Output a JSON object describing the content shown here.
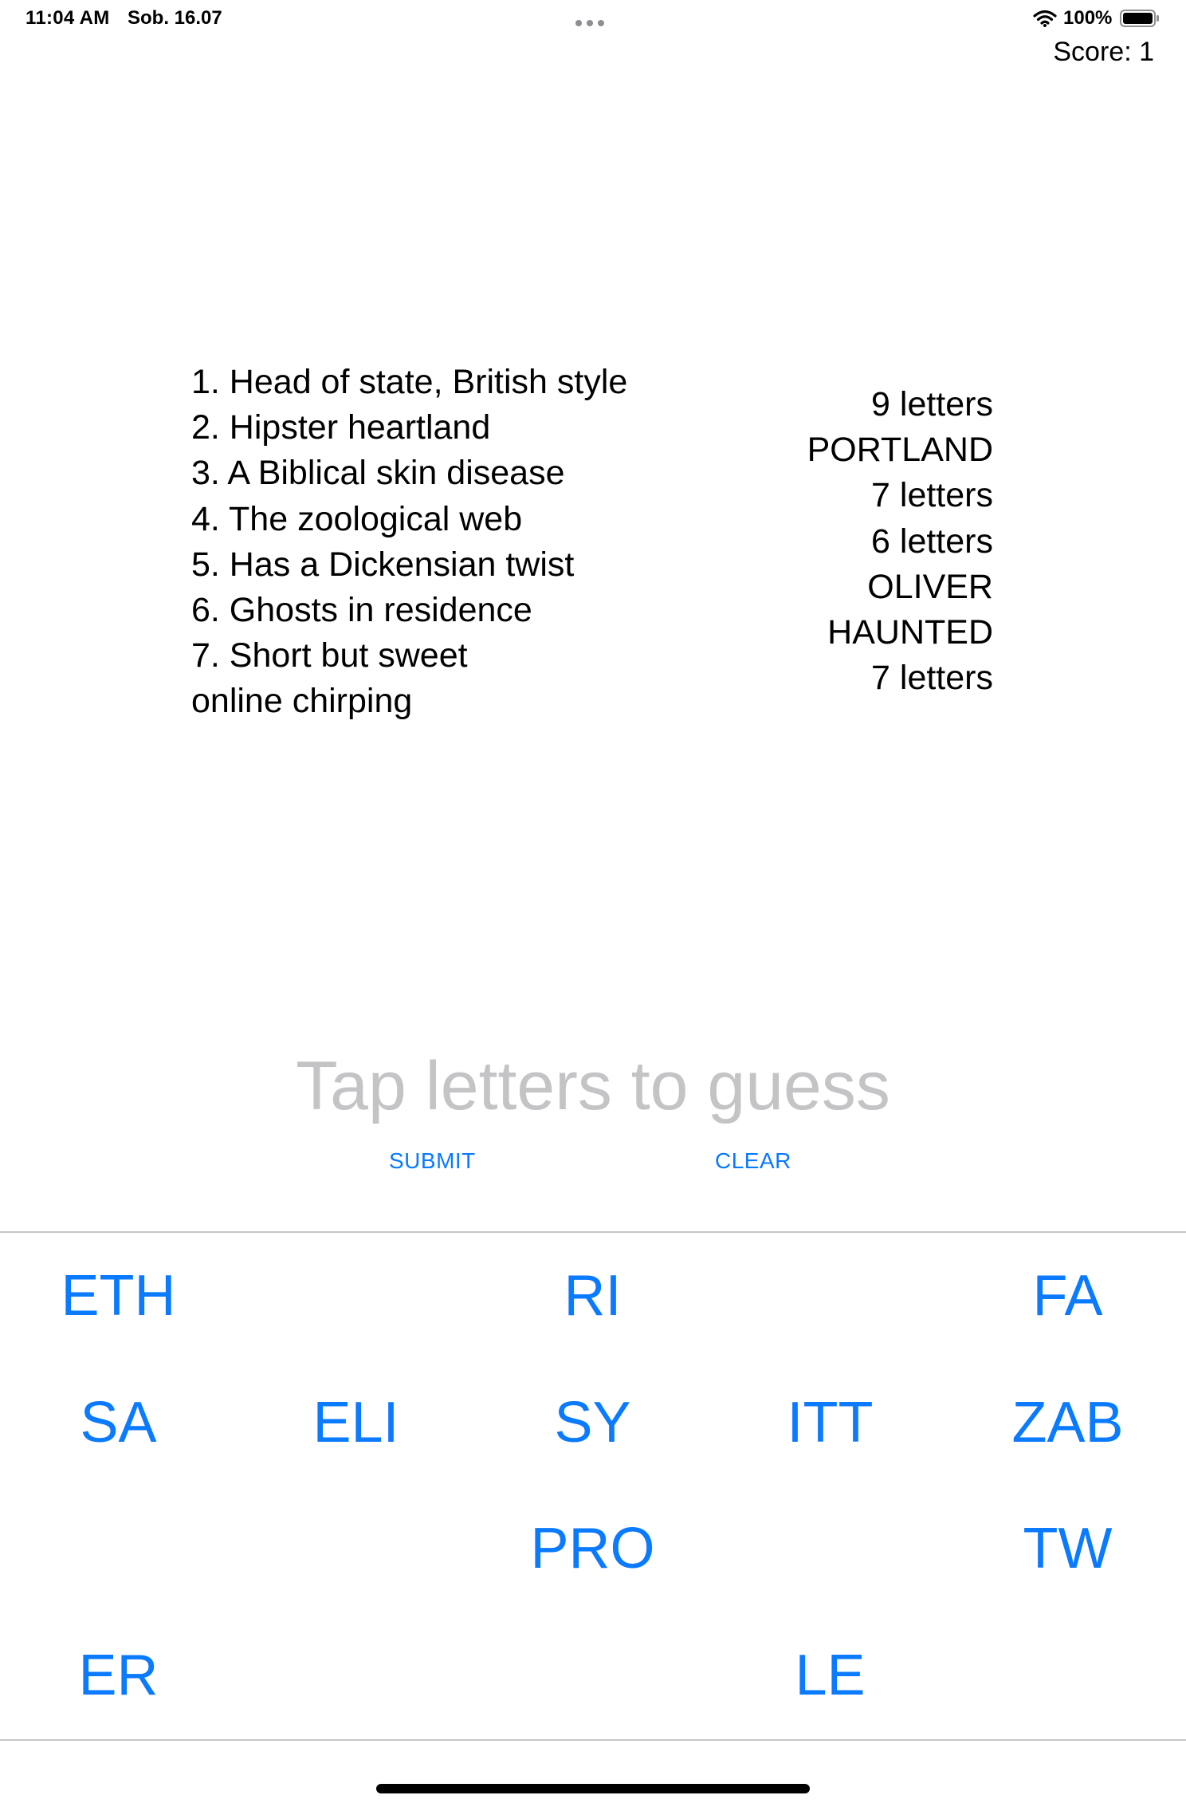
{
  "status_bar": {
    "time": "11:04 AM",
    "date": "Sob. 16.07",
    "battery_percent": "100%",
    "battery_level": 1.0,
    "icons": [
      "wifi-icon",
      "battery-icon",
      "multitask-dots-icon"
    ]
  },
  "score": "Score: 1",
  "clues": [
    "1. Head of state, British style",
    "2. Hipster heartland",
    "3. A Biblical skin disease",
    "4. The zoological web",
    "5. Has a Dickensian twist",
    "6. Ghosts in residence",
    "7. Short but sweet",
    "online chirping"
  ],
  "answers": [
    "9 letters",
    "PORTLAND",
    "7 letters",
    "6 letters",
    "OLIVER",
    "HAUNTED",
    "7 letters"
  ],
  "guess": {
    "placeholder": "Tap letters to guess"
  },
  "actions": {
    "submit_label": "SUBMIT",
    "clear_label": "CLEAR"
  },
  "tiles": [
    [
      "ETH",
      "",
      "RI",
      "",
      "FA"
    ],
    [
      "SA",
      "ELI",
      "SY",
      "ITT",
      "ZAB"
    ],
    [
      "",
      "",
      "PRO",
      "",
      "TW"
    ],
    [
      "ER",
      "",
      "",
      "LE",
      ""
    ]
  ],
  "colors": {
    "accent": "#0a7aff",
    "placeholder": "#c4c4c7",
    "divider": "#c6c6c8"
  }
}
